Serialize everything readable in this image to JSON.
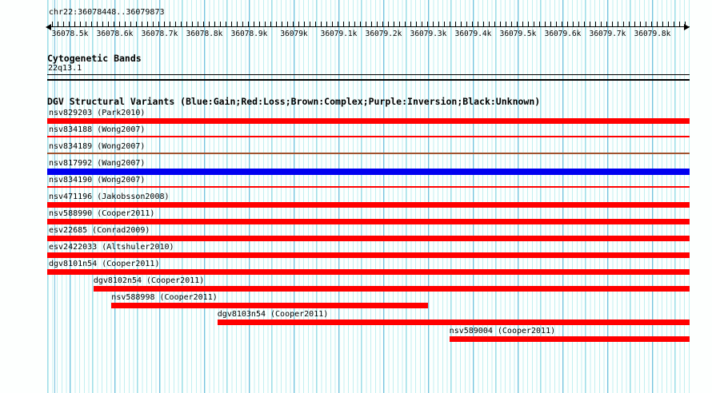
{
  "header": {
    "region": "chr22:36078448..36079873"
  },
  "ruler": {
    "tick_labels": [
      "36078.5k",
      "36078.6k",
      "36078.7k",
      "36078.8k",
      "36078.9k",
      "36079k",
      "36079.1k",
      "36079.2k",
      "36079.3k",
      "36079.4k",
      "36079.5k",
      "36079.6k",
      "36079.7k",
      "36079.8k"
    ]
  },
  "cytogenetic": {
    "title": "Cytogenetic Bands",
    "band": "22q13.1"
  },
  "dgv": {
    "title": "DGV Structural Variants (Blue:Gain;Red:Loss;Brown:Complex;Purple:Inversion;Black:Unknown)",
    "variants": [
      {
        "label": "nsv829203 (Park2010)",
        "variant_type": "loss",
        "color": "#ff0000",
        "bar": "thick",
        "start_frac": 0,
        "end_frac": 1
      },
      {
        "label": "nsv834188 (Wong2007)",
        "variant_type": "loss",
        "color": "#ff0000",
        "bar": "thin",
        "start_frac": 0,
        "end_frac": 1
      },
      {
        "label": "nsv834189 (Wong2007)",
        "variant_type": "complex",
        "color": "#a0522d",
        "bar": "thin",
        "start_frac": 0,
        "end_frac": 1
      },
      {
        "label": "nsv817992 (Wang2007)",
        "variant_type": "gain",
        "color": "#0000f0",
        "bar": "thick",
        "start_frac": 0,
        "end_frac": 1
      },
      {
        "label": "nsv834190 (Wong2007)",
        "variant_type": "loss",
        "color": "#ff0000",
        "bar": "thin",
        "start_frac": 0,
        "end_frac": 1
      },
      {
        "label": "nsv471196 (Jakobsson2008)",
        "variant_type": "loss",
        "color": "#ff0000",
        "bar": "thick",
        "start_frac": 0,
        "end_frac": 1
      },
      {
        "label": "nsv588990 (Cooper2011)",
        "variant_type": "loss",
        "color": "#ff0000",
        "bar": "thick",
        "start_frac": 0,
        "end_frac": 1
      },
      {
        "label": "esv22685 (Conrad2009)",
        "variant_type": "loss",
        "color": "#ff0000",
        "bar": "thick",
        "start_frac": 0,
        "end_frac": 1
      },
      {
        "label": "esv2422033 (Altshuler2010)",
        "variant_type": "loss",
        "color": "#ff0000",
        "bar": "thick",
        "start_frac": 0,
        "end_frac": 1
      },
      {
        "label": "dgv8101n54 (Cooper2011)",
        "variant_type": "loss",
        "color": "#ff0000",
        "bar": "thick",
        "start_frac": 0,
        "end_frac": 1
      },
      {
        "label": "dgv8102n54 (Cooper2011)",
        "variant_type": "loss",
        "color": "#ff0000",
        "bar": "thick",
        "start_frac": 0.072,
        "end_frac": 1
      },
      {
        "label": "nsv588998 (Cooper2011)",
        "variant_type": "loss",
        "color": "#ff0000",
        "bar": "thick",
        "start_frac": 0.1,
        "end_frac": 0.593
      },
      {
        "label": "dgv8103n54 (Cooper2011)",
        "variant_type": "loss",
        "color": "#ff0000",
        "bar": "thick",
        "start_frac": 0.265,
        "end_frac": 1
      },
      {
        "label": "nsv589004 (Cooper2011)",
        "variant_type": "loss",
        "color": "#ff0000",
        "bar": "thick",
        "start_frac": 0.626,
        "end_frac": 1
      }
    ]
  },
  "colors": {
    "loss_red": "#ff0000",
    "gain_blue": "#0000f0",
    "complex_brown": "#a0522d",
    "grid_light": "#c2eff1",
    "grid_medium": "#a3dde8",
    "grid_major": "#79c0e0"
  }
}
